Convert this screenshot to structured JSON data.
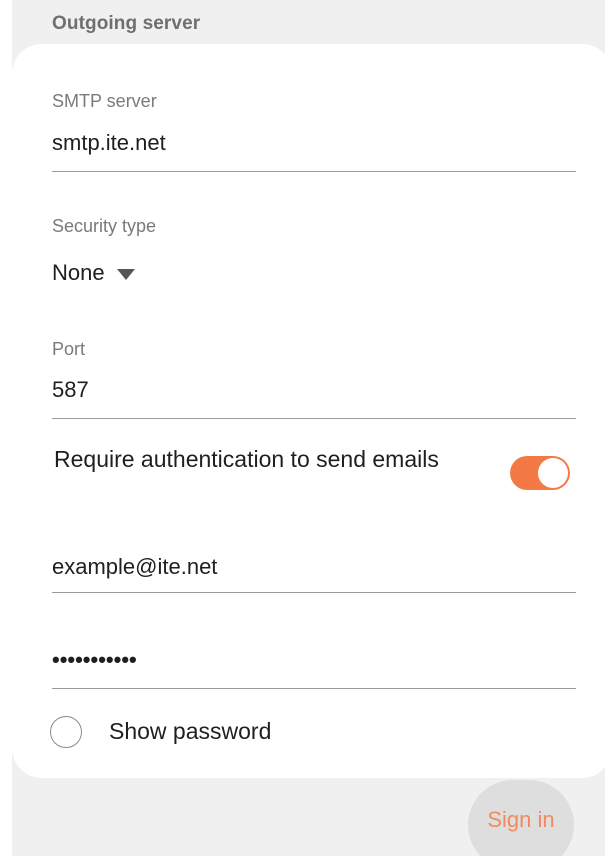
{
  "section": {
    "title": "Outgoing server"
  },
  "smtp": {
    "label": "SMTP server",
    "value": "smtp.ite.net"
  },
  "security": {
    "label": "Security type",
    "value": "None"
  },
  "port": {
    "label": "Port",
    "value": "587"
  },
  "auth": {
    "label": "Require authentication to send emails",
    "enabled": true
  },
  "email": {
    "value": "example@ite.net"
  },
  "password": {
    "masked": "•••••••••••"
  },
  "show_password": {
    "label": "Show password",
    "checked": false
  },
  "actions": {
    "sign_in": "Sign in"
  },
  "colors": {
    "accent": "#f47a45",
    "background": "#f0f0f0",
    "card": "#ffffff"
  }
}
